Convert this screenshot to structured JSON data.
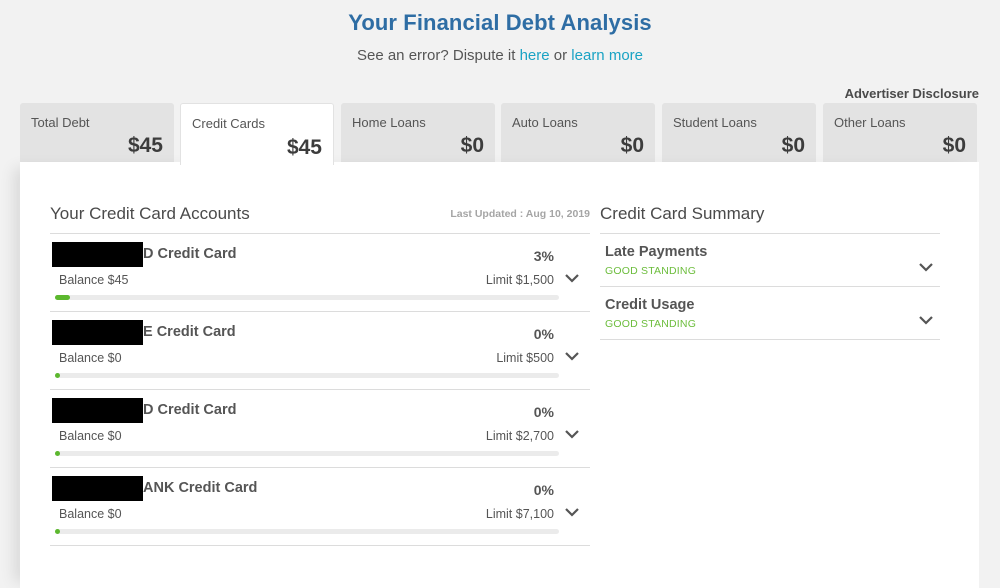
{
  "header": {
    "title": "Your Financial Debt Analysis",
    "subtitle_prefix": "See an error? Dispute it ",
    "dispute_link": "here",
    "subtitle_middle": " or ",
    "learn_link": "learn more"
  },
  "advertiser_disclosure": "Advertiser Disclosure",
  "tabs": [
    {
      "label": "Total Debt",
      "amount": "$45",
      "active": false
    },
    {
      "label": "Credit Cards",
      "amount": "$45",
      "active": true
    },
    {
      "label": "Home Loans",
      "amount": "$0",
      "active": false
    },
    {
      "label": "Auto Loans",
      "amount": "$0",
      "active": false
    },
    {
      "label": "Student Loans",
      "amount": "$0",
      "active": false
    },
    {
      "label": "Other Loans",
      "amount": "$0",
      "active": false
    }
  ],
  "accounts_section": {
    "title": "Your Credit Card Accounts",
    "last_updated": "Last Updated : Aug 10, 2019",
    "accounts": [
      {
        "name_visible": "D Credit Card",
        "utilization": "3%",
        "utilization_value": 3,
        "balance": "Balance $45",
        "limit": "Limit $1,500"
      },
      {
        "name_visible": "E Credit Card",
        "utilization": "0%",
        "utilization_value": 0,
        "balance": "Balance $0",
        "limit": "Limit $500"
      },
      {
        "name_visible": "D Credit Card",
        "utilization": "0%",
        "utilization_value": 0,
        "balance": "Balance $0",
        "limit": "Limit $2,700"
      },
      {
        "name_visible": "ANK Credit Card",
        "utilization": "0%",
        "utilization_value": 0,
        "balance": "Balance $0",
        "limit": "Limit $7,100"
      }
    ]
  },
  "summary_section": {
    "title": "Credit Card Summary",
    "items": [
      {
        "label": "Late Payments",
        "status": "GOOD STANDING"
      },
      {
        "label": "Credit Usage",
        "status": "GOOD STANDING"
      }
    ]
  },
  "colors": {
    "title_blue": "#2e6da4",
    "link_teal": "#1aa3c4",
    "good_green": "#6cbd3c",
    "bar_fill_green": "#5cb82e"
  }
}
